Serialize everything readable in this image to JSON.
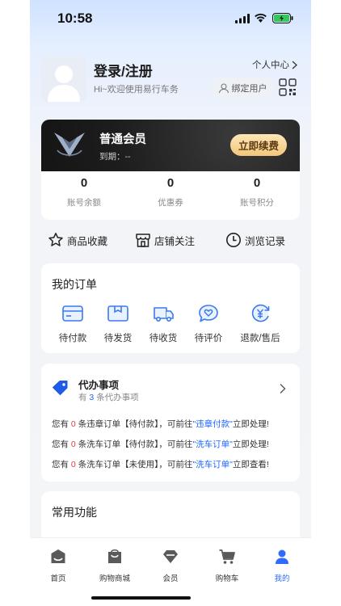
{
  "status_bar": {
    "time": "10:58"
  },
  "profile": {
    "login_label": "登录/注册",
    "welcome": "Hi~欢迎使用易行车务",
    "center_link": "个人中心",
    "bind_button": "绑定用户"
  },
  "membership": {
    "title": "普通会员",
    "expiry": "到期：--",
    "renew_button": "立即续费",
    "stats": [
      {
        "value": "0",
        "label": "账号余额"
      },
      {
        "value": "0",
        "label": "优惠券"
      },
      {
        "value": "0",
        "label": "账号积分"
      }
    ]
  },
  "quick_links": [
    {
      "label": "商品收藏",
      "icon": "star-icon"
    },
    {
      "label": "店铺关注",
      "icon": "store-icon"
    },
    {
      "label": "浏览记录",
      "icon": "clock-icon"
    }
  ],
  "orders": {
    "title": "我的订单",
    "items": [
      {
        "label": "待付款",
        "icon": "wallet-icon"
      },
      {
        "label": "待发货",
        "icon": "box-icon"
      },
      {
        "label": "待收货",
        "icon": "truck-icon"
      },
      {
        "label": "待评价",
        "icon": "comment-heart-icon"
      },
      {
        "label": "退款/售后",
        "icon": "refund-icon"
      }
    ]
  },
  "agenda": {
    "title": "代办事项",
    "sub_prefix": "有",
    "count": "3",
    "sub_suffix": "条代办事项",
    "rows": [
      {
        "prefix": "您有",
        "count": "0",
        "middle": "条违章订单【待付款】，可前往",
        "link": "\"违章付款\"",
        "suffix": "立即处理!"
      },
      {
        "prefix": "您有",
        "count": "0",
        "middle": "条洗车订单【待付款】，可前往",
        "link": "\"洗车订单\"",
        "suffix": "立即处理!"
      },
      {
        "prefix": "您有",
        "count": "0",
        "middle": "条洗车订单【未使用】，可前往",
        "link": "\"洗车订单\"",
        "suffix": "立即查看!"
      }
    ]
  },
  "common": {
    "title": "常用功能"
  },
  "tabbar": [
    {
      "label": "首页",
      "icon": "home-icon"
    },
    {
      "label": "购物商城",
      "icon": "shop-bag-icon"
    },
    {
      "label": "会员",
      "icon": "diamond-icon"
    },
    {
      "label": "购物车",
      "icon": "cart-icon"
    },
    {
      "label": "我的",
      "icon": "user-icon",
      "active": true
    }
  ],
  "colors": {
    "accent": "#2f6bff",
    "link": "#1e66ff",
    "alert": "#e63a3a",
    "gold": "#f2c77a"
  }
}
